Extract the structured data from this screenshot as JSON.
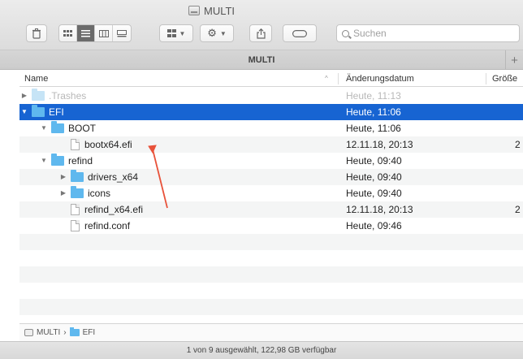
{
  "window": {
    "title": "MULTI"
  },
  "toolbar": {
    "search_placeholder": "Suchen"
  },
  "tabbar": {
    "label": "MULTI",
    "plus": "+"
  },
  "columns": {
    "name": "Name",
    "date": "Änderungsdatum",
    "size": "Größe"
  },
  "rows": [
    {
      "name": ".Trashes",
      "date": "Heute, 11:13",
      "size": "",
      "kind": "folder",
      "level": 0,
      "expander": "▶",
      "state": "dim"
    },
    {
      "name": "EFI",
      "date": "Heute, 11:06",
      "size": "",
      "kind": "folder",
      "level": 0,
      "expander": "▼",
      "state": "selected"
    },
    {
      "name": "BOOT",
      "date": "Heute, 11:06",
      "size": "",
      "kind": "folder",
      "level": 1,
      "expander": "▼",
      "state": ""
    },
    {
      "name": "bootx64.efi",
      "date": "12.11.18, 20:13",
      "size": "2",
      "kind": "file",
      "level": 2,
      "expander": "",
      "state": ""
    },
    {
      "name": "refind",
      "date": "Heute, 09:40",
      "size": "",
      "kind": "folder",
      "level": 1,
      "expander": "▼",
      "state": ""
    },
    {
      "name": "drivers_x64",
      "date": "Heute, 09:40",
      "size": "",
      "kind": "folder",
      "level": 2,
      "expander": "▶",
      "state": ""
    },
    {
      "name": "icons",
      "date": "Heute, 09:40",
      "size": "",
      "kind": "folder",
      "level": 2,
      "expander": "▶",
      "state": ""
    },
    {
      "name": "refind_x64.efi",
      "date": "12.11.18, 20:13",
      "size": "2",
      "kind": "file",
      "level": 2,
      "expander": "",
      "state": ""
    },
    {
      "name": "refind.conf",
      "date": "Heute, 09:46",
      "size": "",
      "kind": "file",
      "level": 2,
      "expander": "",
      "state": ""
    }
  ],
  "pathbar": {
    "volume": "MULTI",
    "separator": "›",
    "folder": "EFI"
  },
  "status": {
    "text": "1 von 9 ausgewählt, 122,98 GB verfügbar"
  },
  "colors": {
    "selection": "#1764d2",
    "folder": "#5fb8ee",
    "annotation_arrow": "#e8523a"
  }
}
